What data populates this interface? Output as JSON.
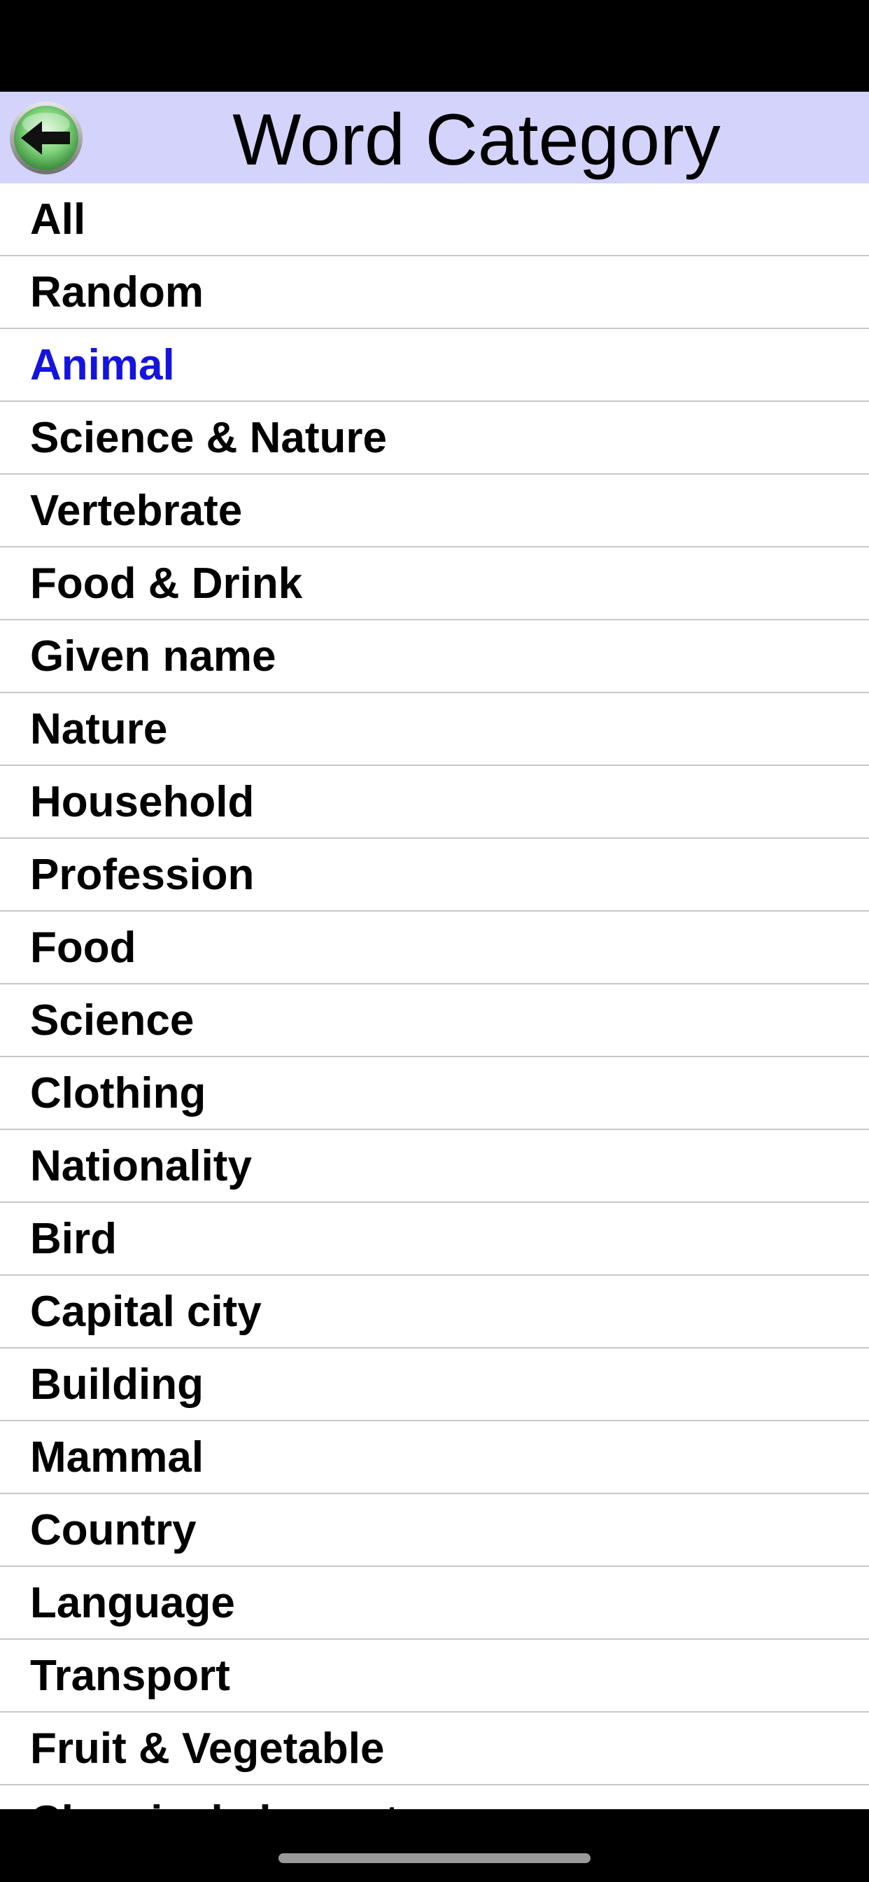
{
  "header": {
    "title": "Word Category",
    "back_icon": "back-arrow-icon",
    "background_color": "#d3d3fb"
  },
  "categories": {
    "selected": "Animal",
    "selected_color": "#1414e0",
    "items": [
      {
        "label": "All"
      },
      {
        "label": "Random"
      },
      {
        "label": "Animal"
      },
      {
        "label": "Science & Nature"
      },
      {
        "label": "Vertebrate"
      },
      {
        "label": "Food & Drink"
      },
      {
        "label": "Given name"
      },
      {
        "label": "Nature"
      },
      {
        "label": "Household"
      },
      {
        "label": "Profession"
      },
      {
        "label": "Food"
      },
      {
        "label": "Science"
      },
      {
        "label": "Clothing"
      },
      {
        "label": "Nationality"
      },
      {
        "label": "Bird"
      },
      {
        "label": "Capital city"
      },
      {
        "label": "Building"
      },
      {
        "label": "Mammal"
      },
      {
        "label": "Country"
      },
      {
        "label": "Language"
      },
      {
        "label": "Transport"
      },
      {
        "label": "Fruit & Vegetable"
      },
      {
        "label": "Chemical element"
      }
    ]
  }
}
